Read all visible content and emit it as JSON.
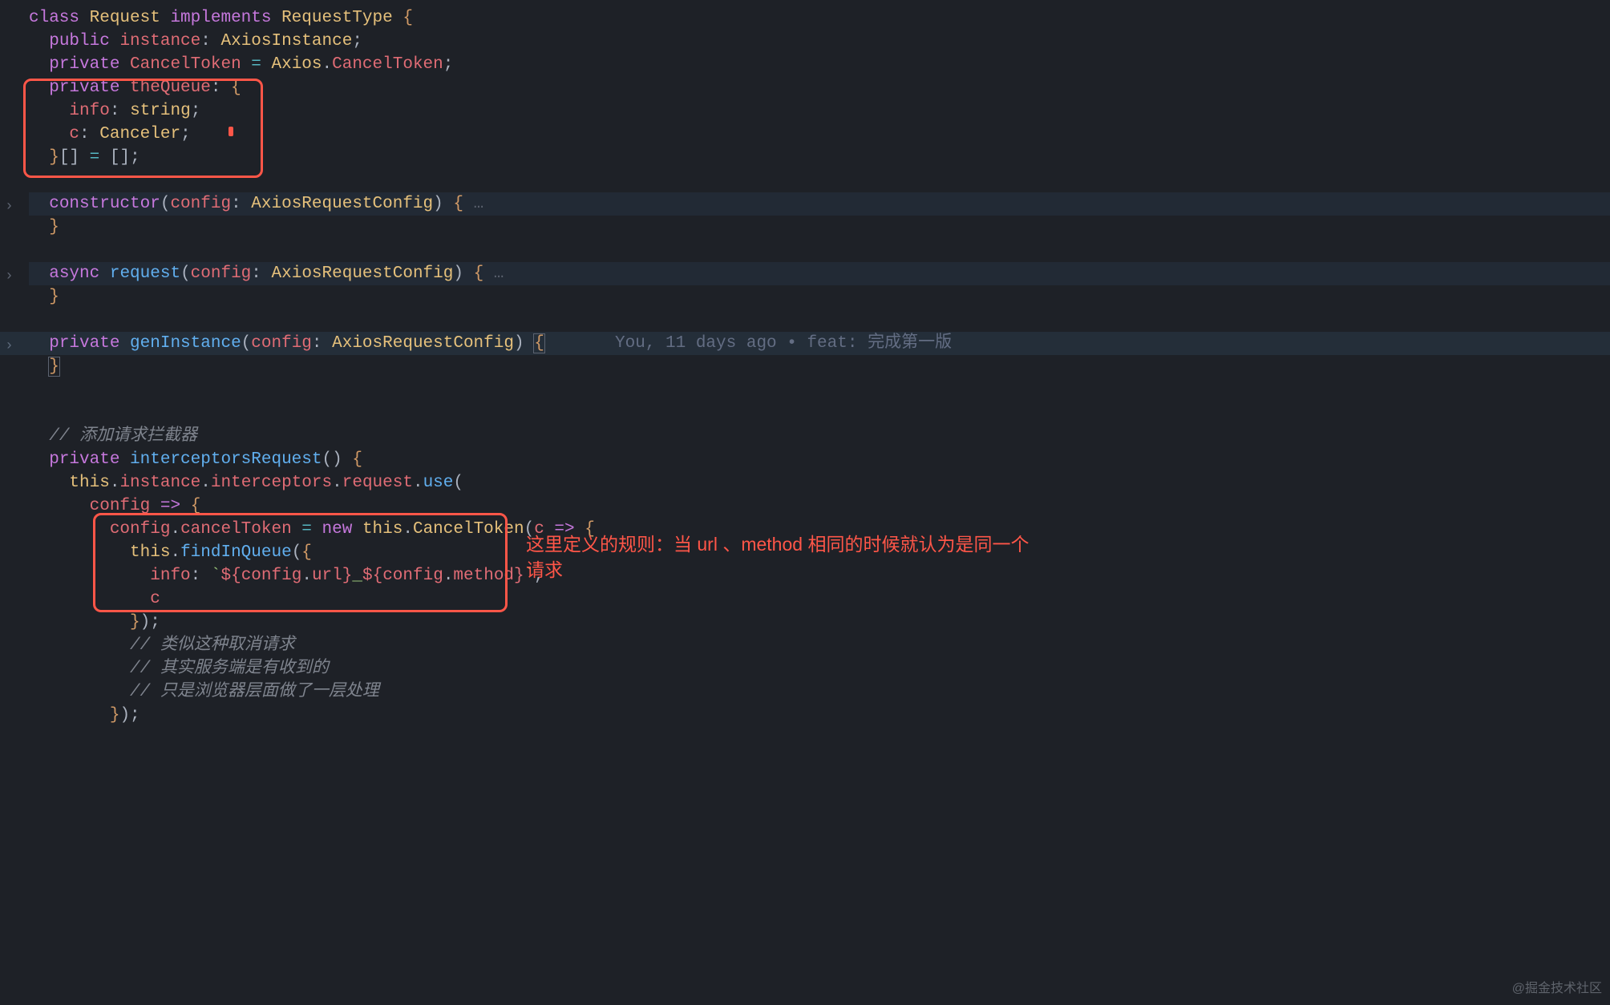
{
  "lines": {
    "l1": {
      "pre": "",
      "tokens": [
        [
          "kw",
          "class "
        ],
        [
          "cls",
          "Request "
        ],
        [
          "kw",
          "implements "
        ],
        [
          "cls",
          "RequestType "
        ],
        [
          "bra",
          "{"
        ]
      ]
    },
    "l2": {
      "pre": "  ",
      "tokens": [
        [
          "kw",
          "public "
        ],
        [
          "var",
          "instance"
        ],
        [
          "pun",
          ": "
        ],
        [
          "cls",
          "AxiosInstance"
        ],
        [
          "pun",
          ";"
        ]
      ]
    },
    "l3": {
      "pre": "  ",
      "tokens": [
        [
          "kw",
          "private "
        ],
        [
          "var",
          "CancelToken"
        ],
        [
          "pun",
          " "
        ],
        [
          "op",
          "="
        ],
        [
          "pun",
          " "
        ],
        [
          "cls",
          "Axios"
        ],
        [
          "pun",
          "."
        ],
        [
          "var",
          "CancelToken"
        ],
        [
          "pun",
          ";"
        ]
      ]
    },
    "l4": {
      "pre": "  ",
      "tokens": [
        [
          "kw",
          "private "
        ],
        [
          "var",
          "theQueue"
        ],
        [
          "pun",
          ": "
        ],
        [
          "bra",
          "{"
        ]
      ]
    },
    "l5": {
      "pre": "    ",
      "tokens": [
        [
          "var",
          "info"
        ],
        [
          "pun",
          ": "
        ],
        [
          "cls",
          "string"
        ],
        [
          "pun",
          ";"
        ]
      ]
    },
    "l6": {
      "pre": "    ",
      "tokens": [
        [
          "var",
          "c"
        ],
        [
          "pun",
          ": "
        ],
        [
          "cls",
          "Canceler"
        ],
        [
          "pun",
          ";"
        ]
      ]
    },
    "l7": {
      "pre": "  ",
      "tokens": [
        [
          "bra",
          "}"
        ],
        [
          "pun",
          "[] "
        ],
        [
          "op",
          "="
        ],
        [
          "pun",
          " []"
        ],
        [
          "pun",
          ";"
        ]
      ]
    },
    "l8": {
      "pre": "",
      "tokens": []
    },
    "l9": {
      "pre": "  ",
      "tokens": [
        [
          "kw",
          "constructor"
        ],
        [
          "pun",
          "("
        ],
        [
          "var",
          "config"
        ],
        [
          "pun",
          ": "
        ],
        [
          "cls",
          "AxiosRequestConfig"
        ],
        [
          "pun",
          ") "
        ],
        [
          "bra",
          "{"
        ],
        [
          "fold-dots",
          " …"
        ]
      ]
    },
    "l10": {
      "pre": "  ",
      "tokens": [
        [
          "bra",
          "}"
        ]
      ]
    },
    "l11": {
      "pre": "",
      "tokens": []
    },
    "l12": {
      "pre": "  ",
      "tokens": [
        [
          "kw",
          "async "
        ],
        [
          "fn",
          "request"
        ],
        [
          "pun",
          "("
        ],
        [
          "var",
          "config"
        ],
        [
          "pun",
          ": "
        ],
        [
          "cls",
          "AxiosRequestConfig"
        ],
        [
          "pun",
          ") "
        ],
        [
          "bra",
          "{"
        ],
        [
          "fold-dots",
          " …"
        ]
      ]
    },
    "l13": {
      "pre": "  ",
      "tokens": [
        [
          "bra",
          "}"
        ]
      ]
    },
    "l14": {
      "pre": "",
      "tokens": []
    },
    "l15": {
      "pre": "  ",
      "tokens": [
        [
          "kw",
          "private "
        ],
        [
          "fn",
          "genInstance"
        ],
        [
          "pun",
          "("
        ],
        [
          "var",
          "config"
        ],
        [
          "pun",
          ": "
        ],
        [
          "cls",
          "AxiosRequestConfig"
        ],
        [
          "pun",
          ") "
        ],
        [
          "bra",
          "{"
        ]
      ]
    },
    "l15lens": "You, 11 days ago • feat: 完成第一版",
    "l16": {
      "pre": "  ",
      "tokens": [
        [
          "bra",
          "}"
        ]
      ]
    },
    "l17": {
      "pre": "",
      "tokens": []
    },
    "l18": {
      "pre": "",
      "tokens": []
    },
    "l19": {
      "pre": "  ",
      "tokens": [
        [
          "cmt",
          "// 添加请求拦截器"
        ]
      ]
    },
    "l20": {
      "pre": "  ",
      "tokens": [
        [
          "kw",
          "private "
        ],
        [
          "fn",
          "interceptorsRequest"
        ],
        [
          "pun",
          "() "
        ],
        [
          "bra",
          "{"
        ]
      ]
    },
    "l21": {
      "pre": "    ",
      "tokens": [
        [
          "this",
          "this"
        ],
        [
          "pun",
          "."
        ],
        [
          "var",
          "instance"
        ],
        [
          "pun",
          "."
        ],
        [
          "var",
          "interceptors"
        ],
        [
          "pun",
          "."
        ],
        [
          "var",
          "request"
        ],
        [
          "pun",
          "."
        ],
        [
          "fn",
          "use"
        ],
        [
          "pun",
          "("
        ]
      ]
    },
    "l22": {
      "pre": "      ",
      "tokens": [
        [
          "var",
          "config"
        ],
        [
          "pun",
          " "
        ],
        [
          "kw",
          "=>"
        ],
        [
          "pun",
          " "
        ],
        [
          "bra",
          "{"
        ]
      ]
    },
    "l23": {
      "pre": "        ",
      "tokens": [
        [
          "var",
          "config"
        ],
        [
          "pun",
          "."
        ],
        [
          "var",
          "cancelToken"
        ],
        [
          "pun",
          " "
        ],
        [
          "op",
          "="
        ],
        [
          "pun",
          " "
        ],
        [
          "kw",
          "new"
        ],
        [
          "pun",
          " "
        ],
        [
          "this",
          "this"
        ],
        [
          "pun",
          "."
        ],
        [
          "cls",
          "CancelToken"
        ],
        [
          "pun",
          "("
        ],
        [
          "var",
          "c"
        ],
        [
          "pun",
          " "
        ],
        [
          "kw",
          "=>"
        ],
        [
          "pun",
          " "
        ],
        [
          "bra",
          "{"
        ]
      ]
    },
    "l24": {
      "pre": "          ",
      "tokens": [
        [
          "this",
          "this"
        ],
        [
          "pun",
          "."
        ],
        [
          "fn",
          "findInQueue"
        ],
        [
          "pun",
          "("
        ],
        [
          "bra",
          "{"
        ]
      ]
    },
    "l25": {
      "pre": "            ",
      "tokens": [
        [
          "var",
          "info"
        ],
        [
          "pun",
          ": "
        ],
        [
          "str",
          "`"
        ],
        [
          "tint",
          "${"
        ],
        [
          "var",
          "config"
        ],
        [
          "pun",
          "."
        ],
        [
          "var",
          "url"
        ],
        [
          "tint",
          "}"
        ],
        [
          "str",
          "_"
        ],
        [
          "tint",
          "${"
        ],
        [
          "var",
          "config"
        ],
        [
          "pun",
          "."
        ],
        [
          "var",
          "method"
        ],
        [
          "tint",
          "}"
        ],
        [
          "str",
          "`"
        ],
        [
          "pun",
          ","
        ]
      ]
    },
    "l26": {
      "pre": "            ",
      "tokens": [
        [
          "var",
          "c"
        ]
      ]
    },
    "l27": {
      "pre": "          ",
      "tokens": [
        [
          "bra",
          "}"
        ],
        [
          "pun",
          ");"
        ]
      ]
    },
    "l28": {
      "pre": "          ",
      "tokens": [
        [
          "cmt",
          "// 类似这种取消请求"
        ]
      ]
    },
    "l29": {
      "pre": "          ",
      "tokens": [
        [
          "cmt",
          "// 其实服务端是有收到的"
        ]
      ]
    },
    "l30": {
      "pre": "          ",
      "tokens": [
        [
          "cmt",
          "// 只是浏览器层面做了一层处理"
        ]
      ]
    },
    "l31": {
      "pre": "        ",
      "tokens": [
        [
          "bra",
          "}"
        ],
        [
          "pun",
          ");"
        ]
      ]
    }
  },
  "order": [
    "l1",
    "l2",
    "l3",
    "l4",
    "l5",
    "l6",
    "l7",
    "l8",
    "l9",
    "l10",
    "l11",
    "l12",
    "l13",
    "l14",
    "l15",
    "l16",
    "l17",
    "l18",
    "l19",
    "l20",
    "l21",
    "l22",
    "l23",
    "l24",
    "l25",
    "l26",
    "l27",
    "l28",
    "l29",
    "l30",
    "l31"
  ],
  "highlights": {
    "l9": true,
    "l12": true
  },
  "current_line": "l15",
  "fold_markers": {
    "l9": ">",
    "l12": ">",
    "l15": ">"
  },
  "annotation_text": "这里定义的规则：当 url 、method 相同的时候就认为是同一个请求",
  "watermark": "@掘金技术社区",
  "codelens_for": "l15"
}
